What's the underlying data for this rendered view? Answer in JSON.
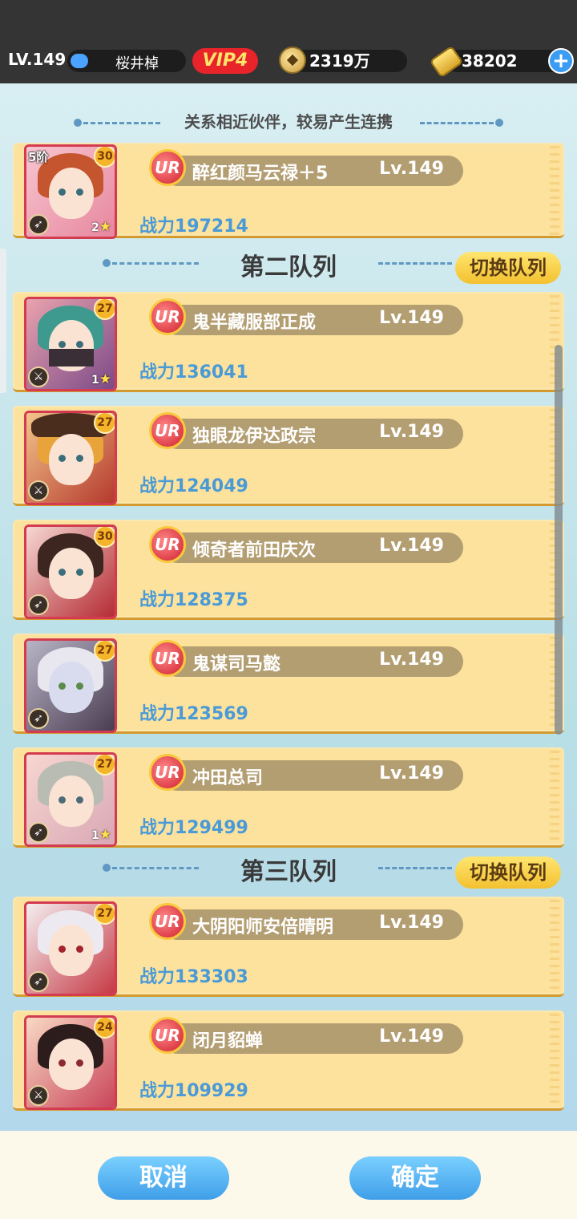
{
  "player": {
    "level": "LV.149",
    "name": "桜井棹",
    "vip": "VIP4",
    "coins": "2319万",
    "gold": "38202"
  },
  "hint": "关系相近伙伴，较易产生连携",
  "sections": [
    {
      "title": "第二队列",
      "switch_label": "切换队列"
    },
    {
      "title": "第三队列",
      "switch_label": "切换队列"
    }
  ],
  "heroes": [
    {
      "name": "醉红颜马云禄＋5",
      "level": "Lv.149",
      "power": "战力197214",
      "badge": "30",
      "rank": "5阶",
      "stars": "2",
      "rarity": "UR"
    },
    {
      "name": "鬼半藏服部正成",
      "level": "Lv.149",
      "power": "战力136041",
      "badge": "27",
      "rank": "",
      "stars": "1",
      "rarity": "UR"
    },
    {
      "name": "独眼龙伊达政宗",
      "level": "Lv.149",
      "power": "战力124049",
      "badge": "27",
      "rank": "",
      "stars": "",
      "rarity": "UR"
    },
    {
      "name": "倾奇者前田庆次",
      "level": "Lv.149",
      "power": "战力128375",
      "badge": "30",
      "rank": "",
      "stars": "",
      "rarity": "UR"
    },
    {
      "name": "鬼谋司马懿",
      "level": "Lv.149",
      "power": "战力123569",
      "badge": "27",
      "rank": "",
      "stars": "",
      "rarity": "UR"
    },
    {
      "name": "冲田总司",
      "level": "Lv.149",
      "power": "战力129499",
      "badge": "27",
      "rank": "",
      "stars": "1",
      "rarity": "UR"
    },
    {
      "name": "大阴阳师安倍晴明",
      "level": "Lv.149",
      "power": "战力133303",
      "badge": "27",
      "rank": "",
      "stars": "",
      "rarity": "UR"
    },
    {
      "name": "闭月貂蝉",
      "level": "Lv.149",
      "power": "战力109929",
      "badge": "24",
      "rank": "",
      "stars": "",
      "rarity": "UR"
    }
  ],
  "buttons": {
    "cancel": "取消",
    "confirm": "确定"
  },
  "colors": {
    "card": "#fce29c",
    "accent_blue": "#4a9ad8",
    "vip_red": "#e8232a",
    "button_blue": "#3f9ee8"
  }
}
